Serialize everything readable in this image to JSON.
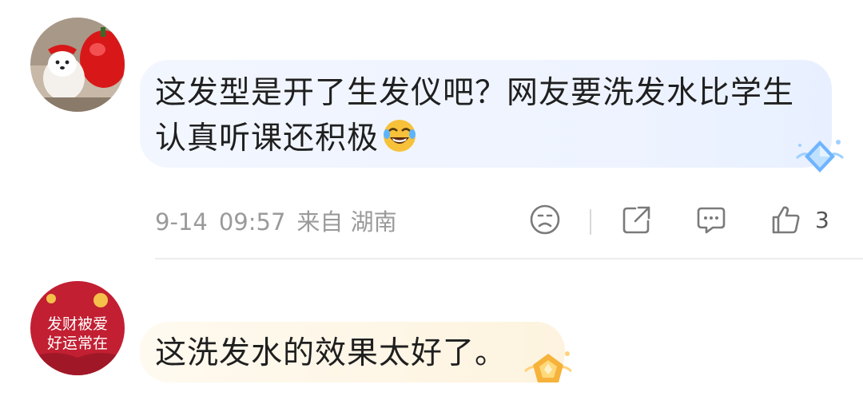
{
  "comments": [
    {
      "text": "这发型是开了生发仪吧？网友要洗发水比学生认真听课还积极",
      "emoji": "laughing-tears-emoji",
      "date": "9-14",
      "time": "09:57",
      "location": "来自 湖南",
      "likes": "3",
      "bubble_color": "#eef3ff",
      "badge": "blue-diamond-badge"
    },
    {
      "text": "这洗发水的效果太好了。",
      "avatar_text_line1": "发财被爱",
      "avatar_text_line2": "好运常在",
      "bubble_color": "#fdf5e4",
      "badge": "gold-crown-badge"
    }
  ],
  "colors": {
    "meta_text": "#9a9a9a",
    "avatar2_bg": "#c21f32",
    "icon_stroke": "#7a7a7a"
  }
}
